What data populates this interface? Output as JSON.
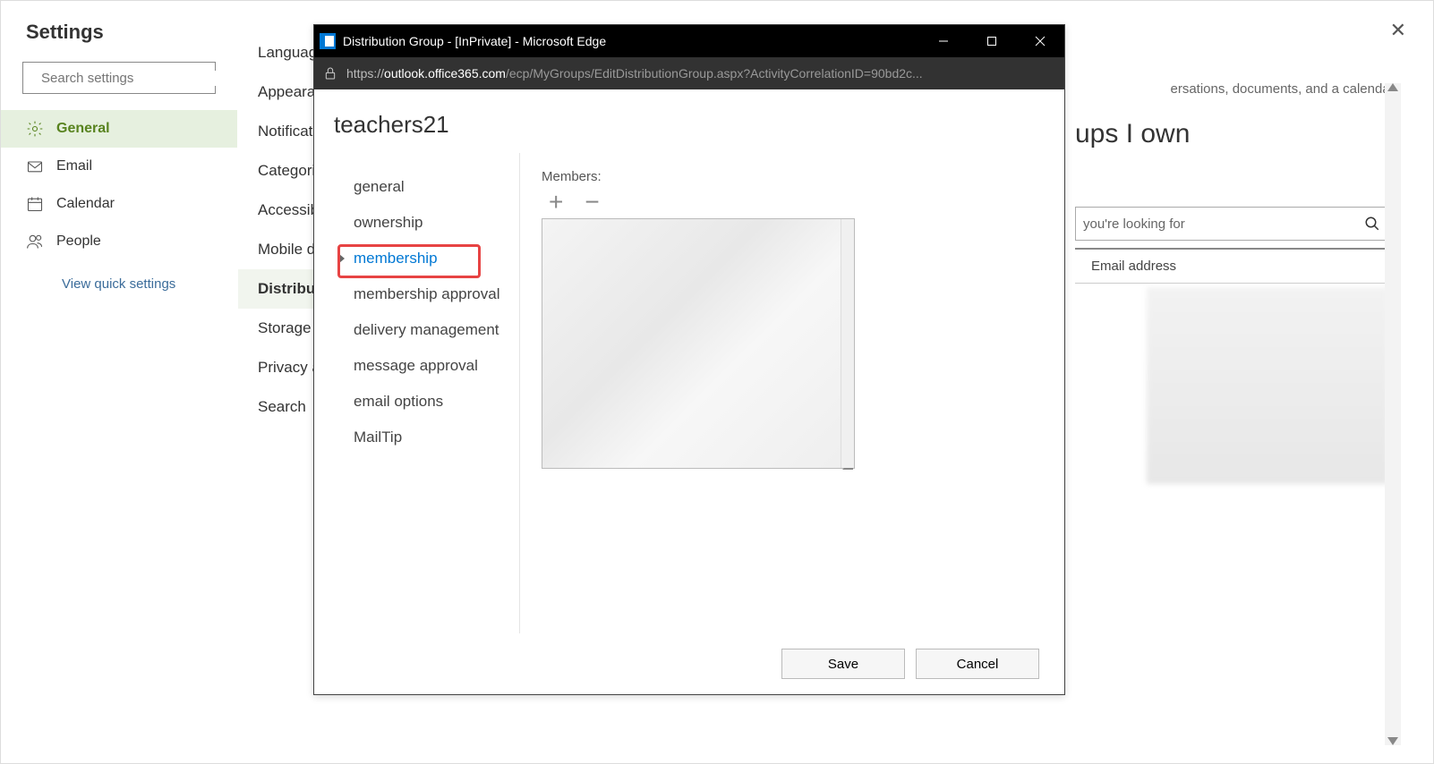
{
  "sidebar": {
    "title": "Settings",
    "search_placeholder": "Search settings",
    "items": [
      {
        "label": "General"
      },
      {
        "label": "Email"
      },
      {
        "label": "Calendar"
      },
      {
        "label": "People"
      }
    ],
    "quick": "View quick settings"
  },
  "midnav": {
    "items": [
      {
        "label": "Language"
      },
      {
        "label": "Appearance"
      },
      {
        "label": "Notifications"
      },
      {
        "label": "Categories"
      },
      {
        "label": "Accessibility"
      },
      {
        "label": "Mobile devices"
      },
      {
        "label": "Distribution groups"
      },
      {
        "label": "Storage"
      },
      {
        "label": "Privacy and data"
      },
      {
        "label": "Search"
      }
    ]
  },
  "right": {
    "desc_fragment": "ersations, documents, and a calendar.",
    "heading_fragment": "ups I own",
    "search_placeholder_fragment": "you're looking for",
    "column_email": "Email address"
  },
  "popup": {
    "window_title": "Distribution Group - [InPrivate] - Microsoft Edge",
    "url_scheme": "https://",
    "url_host": "outlook.office365.com",
    "url_path": "/ecp/MyGroups/EditDistributionGroup.aspx?ActivityCorrelationID=90bd2c...",
    "group_title": "teachers21",
    "nav": [
      {
        "label": "general"
      },
      {
        "label": "ownership"
      },
      {
        "label": "membership"
      },
      {
        "label": "membership approval"
      },
      {
        "label": "delivery management"
      },
      {
        "label": "message approval"
      },
      {
        "label": "email options"
      },
      {
        "label": "MailTip"
      }
    ],
    "members_label": "Members:",
    "save": "Save",
    "cancel": "Cancel"
  }
}
